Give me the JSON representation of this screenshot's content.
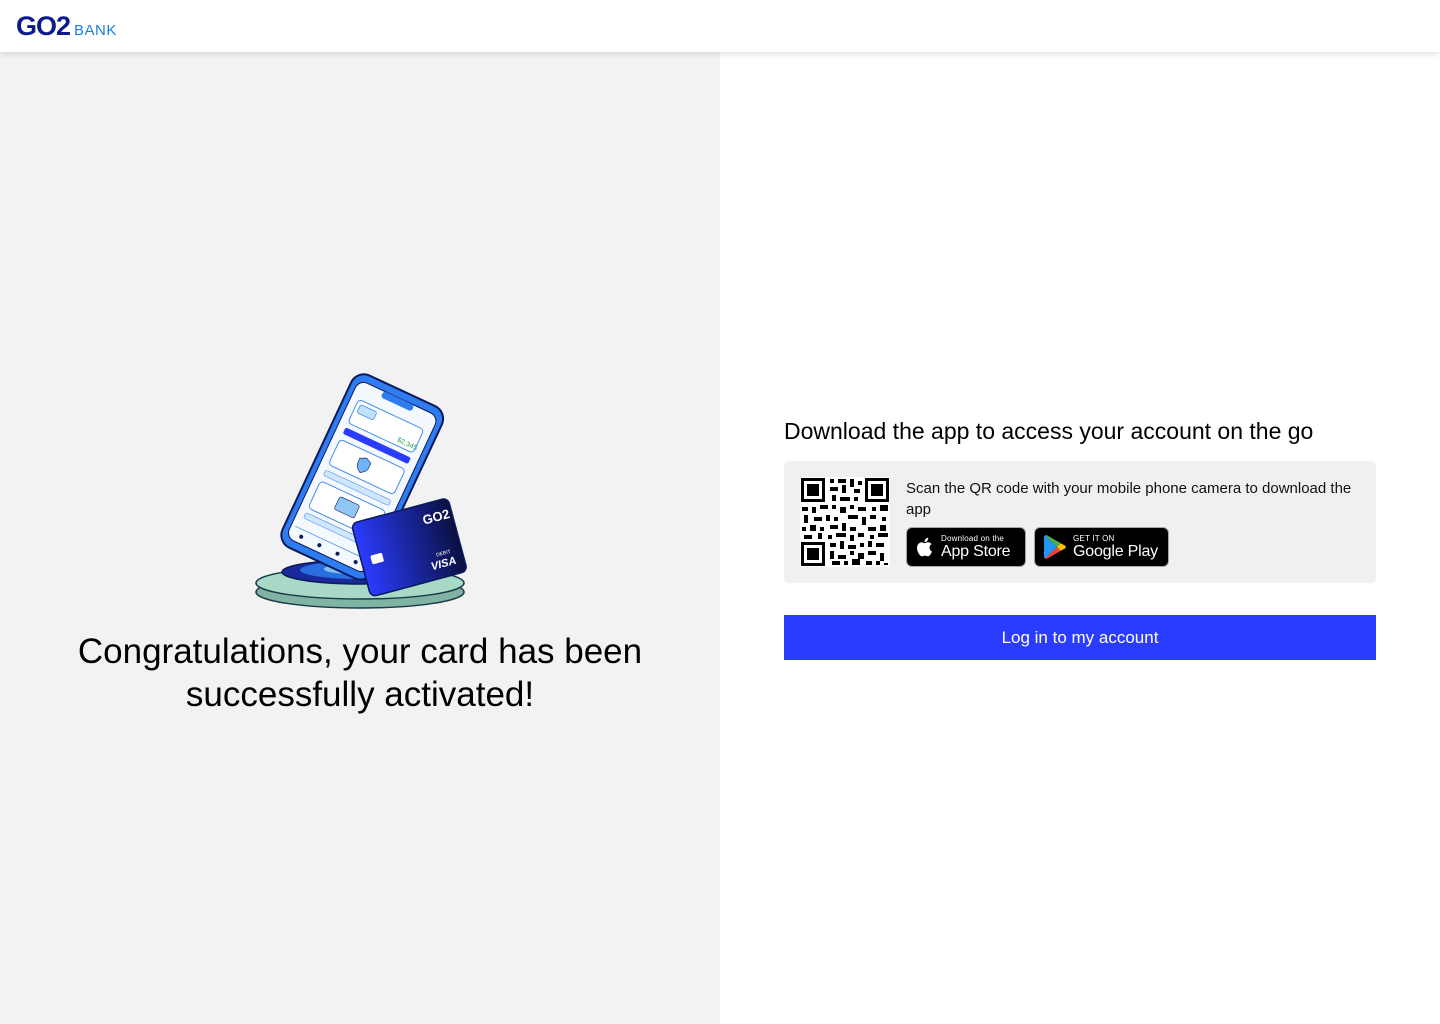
{
  "header": {
    "logo_main": "GO2",
    "logo_suffix": "BANK"
  },
  "left": {
    "illustration_card_brand": "GO2",
    "illustration_card_type": "DEBIT",
    "illustration_card_network": "VISA",
    "illustration_balance": "$2,345",
    "congrats_line1": "Congratulations, your card has been",
    "congrats_line2": "successfully activated!"
  },
  "right": {
    "download_title": "Download the app to access your account on the go",
    "qr_instruction": "Scan the QR code with your mobile phone camera to download the app",
    "app_store": {
      "small": "Download on the",
      "big": "App Store"
    },
    "google_play": {
      "small": "GET IT ON",
      "big": "Google Play"
    },
    "login_label": "Log in to my account"
  },
  "colors": {
    "brand_navy": "#0e1a8c",
    "brand_blue": "#1b7fe0",
    "primary_button": "#2a3cff",
    "left_panel_bg": "#f2f2f2",
    "qr_box_bg": "#f0f0f0"
  }
}
